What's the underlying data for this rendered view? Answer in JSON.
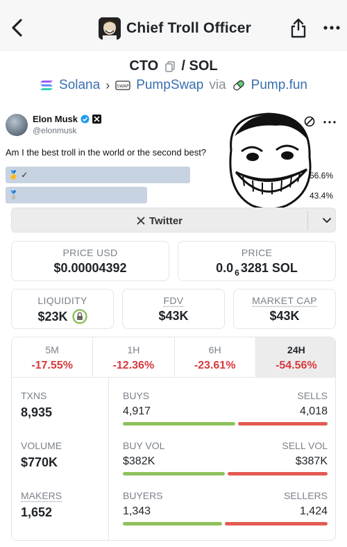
{
  "header": {
    "title": "Chief Troll Officer",
    "back_icon": "back-chevron-icon",
    "share_icon": "share-icon",
    "more_icon": "more-dots-icon"
  },
  "token": {
    "symbol": "CTO",
    "quote": "SOL",
    "separator": "/",
    "chain": "Solana",
    "dex": "PumpSwap",
    "via": "via",
    "launchpad": "Pump.fun"
  },
  "banner": {
    "tweet_name": "Elon Musk",
    "tweet_handle": "@elonmusk",
    "tweet_text": "Am I the best troll in the world or the second best?",
    "poll": [
      {
        "label": "🥇 ✓",
        "pct": "56.6%",
        "fill": 0.566
      },
      {
        "label": "🥈",
        "pct": "43.4%",
        "fill": 0.434
      }
    ],
    "twitter_label": "Twitter"
  },
  "price": {
    "usd_label": "PRICE USD",
    "usd_value": "$0.00004392",
    "native_label": "PRICE",
    "native_prefix": "0.0",
    "native_sub": "6",
    "native_rest": "3281 SOL"
  },
  "market": {
    "liquidity_label": "LIQUIDITY",
    "liquidity_value": "$23K",
    "fdv_label": "FDV",
    "fdv_value": "$43K",
    "mcap_label": "MARKET CAP",
    "mcap_value": "$43K"
  },
  "timeframes": [
    {
      "label": "5M",
      "change": "-17.55%"
    },
    {
      "label": "1H",
      "change": "-12.36%"
    },
    {
      "label": "6H",
      "change": "-23.61%"
    },
    {
      "label": "24H",
      "change": "-54.56%"
    }
  ],
  "stats": {
    "txns_label": "TXNS",
    "txns_value": "8,935",
    "volume_label": "VOLUME",
    "volume_value": "$770K",
    "makers_label": "MAKERS",
    "makers_value": "1,652",
    "buys_label": "BUYS",
    "buys_value": "4,917",
    "sells_label": "SELLS",
    "sells_value": "4,018",
    "buys_fraction": 0.55,
    "buyvol_label": "BUY VOL",
    "buyvol_value": "$382K",
    "sellvol_label": "SELL VOL",
    "sellvol_value": "$387K",
    "buyvol_fraction": 0.497,
    "buyers_label": "BUYERS",
    "buyers_value": "1,343",
    "sellers_label": "SELLERS",
    "sellers_value": "1,424",
    "buyers_fraction": 0.485
  },
  "colors": {
    "positive": "#8fc15c",
    "negative": "#d7393d",
    "link": "#3a6fb0"
  }
}
